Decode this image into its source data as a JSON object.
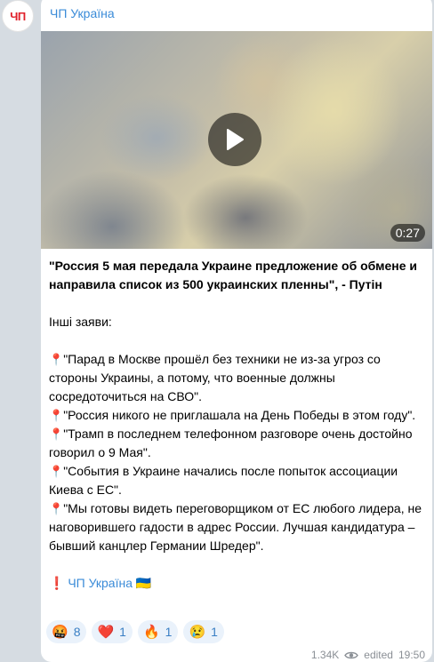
{
  "channel": {
    "avatar_text": "ЧП",
    "name": "ЧП Україна"
  },
  "video": {
    "duration": "0:27"
  },
  "post": {
    "headline": "\"Россия 5 мая передала Украине предложение об обмене и направила список из 500 украинских пленны\", - Путін",
    "intro": "Інші заяви:",
    "items": [
      "\"Парад в Москве прошёл без техники не из-за угроз со стороны Украины, а потому, что военные должны сосредоточиться на СВО\".",
      "\"Россия никого не приглашала на День Победы в этом году\".",
      "\"Трамп в последнем телефонном разговоре очень достойно говорил о 9 Мая\".",
      "\"События в Украине начались после попыток ассоциации Киева с ЕС\".",
      "\"Мы готовы видеть переговорщиком от ЕС любого лидера, не наговорившего гадости в адрес России. Лучшая кандидатура – бывший канцлер Германии Шредер\"."
    ],
    "item_icon": "📍",
    "footer_prefix": "❗",
    "footer_text": "ЧП Україна",
    "footer_flag": "🇺🇦"
  },
  "reactions": [
    {
      "emoji": "🤬",
      "count": "8"
    },
    {
      "emoji": "❤️",
      "count": "1"
    },
    {
      "emoji": "🔥",
      "count": "1"
    },
    {
      "emoji": "😢",
      "count": "1"
    }
  ],
  "meta": {
    "views": "1.34K",
    "edited_label": "edited",
    "time": "19:50",
    "views_icon": "eye-icon"
  },
  "colors": {
    "accent": "#3a8bd8",
    "background": "#d6dce2",
    "bubble": "#ffffff",
    "reaction_bg": "#eaf2fb"
  }
}
